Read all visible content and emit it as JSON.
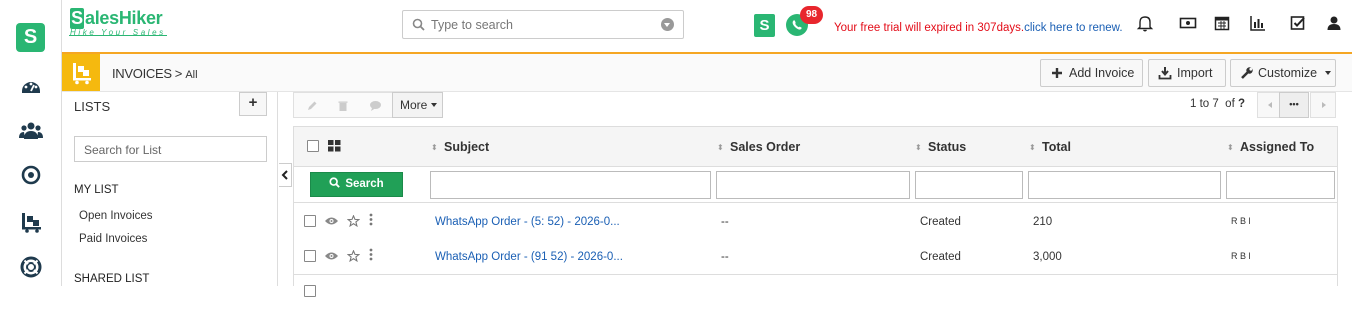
{
  "brand": {
    "name_s": "S",
    "name_rest": "alesHiker",
    "tagline": "Hike Your Sales"
  },
  "search": {
    "placeholder": "Type to search"
  },
  "notifications": {
    "count": "98"
  },
  "trial": {
    "text": "Your free trial will expired in 307days.",
    "link": "click here to renew."
  },
  "breadcrumb": {
    "module": "INVOICES",
    "separator": ">",
    "view": "All"
  },
  "actions": {
    "add": "Add Invoice",
    "import": "Import",
    "customize": "Customize"
  },
  "lists": {
    "title": "LISTS",
    "add": "+",
    "search_placeholder": "Search for List",
    "my_list": "MY LIST",
    "items": [
      "Open Invoices",
      "Paid Invoices"
    ],
    "shared_list": "SHARED LIST"
  },
  "toolbar": {
    "more": "More",
    "pager_range": "1 to 7",
    "pager_of": "of",
    "pager_total": "?",
    "more_pages": "•••"
  },
  "table": {
    "columns": [
      "Subject",
      "Sales Order",
      "Status",
      "Total",
      "Assigned To"
    ],
    "search_button": "Search",
    "rows": [
      {
        "subject": "WhatsApp Order - (5:            52) - 2026-0...",
        "sales_order": "--",
        "status": "Created",
        "total": "210",
        "assigned": "R     B     l"
      },
      {
        "subject": "WhatsApp Order - (91             52) - 2026-0...",
        "sales_order": "--",
        "status": "Created",
        "total": "3,000",
        "assigned": "R     B     l"
      }
    ]
  },
  "colors": {
    "green": "#2ab673",
    "orange": "#f5a623",
    "red": "#e30b17",
    "link": "#1a5fb4",
    "badge": "#e8262d"
  }
}
